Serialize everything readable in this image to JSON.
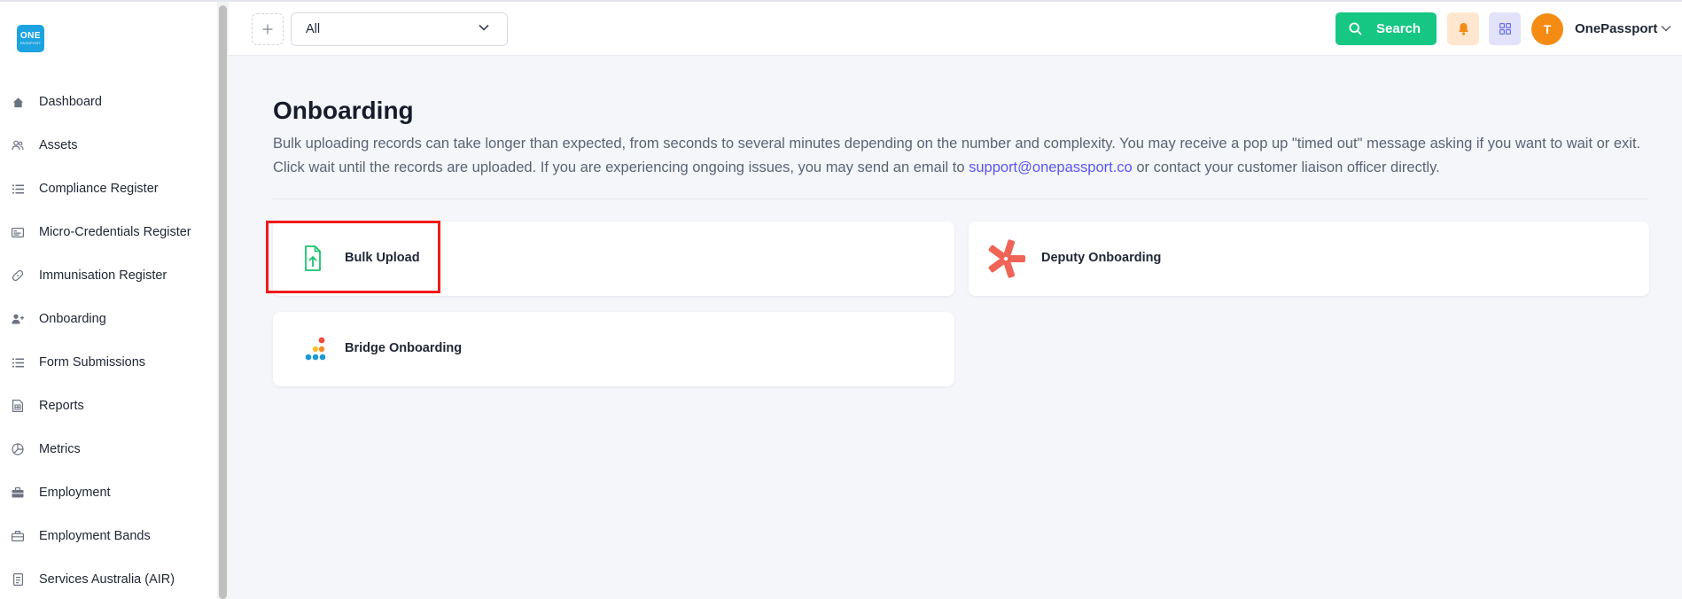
{
  "app": {
    "logo_line1": "ONE",
    "logo_line2": "PASSPORT"
  },
  "sidebar": {
    "items": [
      {
        "label": "Dashboard",
        "icon": "home-icon"
      },
      {
        "label": "Assets",
        "icon": "users-icon"
      },
      {
        "label": "Compliance Register",
        "icon": "list-icon"
      },
      {
        "label": "Micro-Credentials Register",
        "icon": "id-card-icon"
      },
      {
        "label": "Immunisation Register",
        "icon": "bandage-icon"
      },
      {
        "label": "Onboarding",
        "icon": "user-plus-icon"
      },
      {
        "label": "Form Submissions",
        "icon": "list-icon"
      },
      {
        "label": "Reports",
        "icon": "spreadsheet-icon"
      },
      {
        "label": "Metrics",
        "icon": "pie-chart-icon"
      },
      {
        "label": "Employment",
        "icon": "briefcase-icon"
      },
      {
        "label": "Employment Bands",
        "icon": "briefcase-outline-icon"
      },
      {
        "label": "Services Australia (AIR)",
        "icon": "document-icon"
      }
    ]
  },
  "header": {
    "filter_value": "All",
    "search_label": "Search",
    "avatar_initial": "T",
    "user_name": "OnePassport"
  },
  "main": {
    "title": "Onboarding",
    "description_before_link": "Bulk uploading records can take longer than expected, from seconds to several minutes depending on the number and complexity. You may receive a pop up \"timed out\" message asking if you want to wait or exit. Click wait until the records are uploaded. If you are experiencing ongoing issues, you may send an email to ",
    "support_email": "support@onepassport.co",
    "description_after_link": " or contact your customer liaison officer directly.",
    "cards": [
      {
        "label": "Bulk Upload",
        "icon": "file-upload-icon"
      },
      {
        "label": "Deputy Onboarding",
        "icon": "deputy-logo-icon"
      },
      {
        "label": "Bridge Onboarding",
        "icon": "bridge-logo-icon"
      }
    ]
  },
  "colors": {
    "primary_green": "#16c784",
    "highlight_red": "#f01a1a",
    "link_purple": "#5b55f2",
    "avatar_orange": "#f48c14"
  }
}
